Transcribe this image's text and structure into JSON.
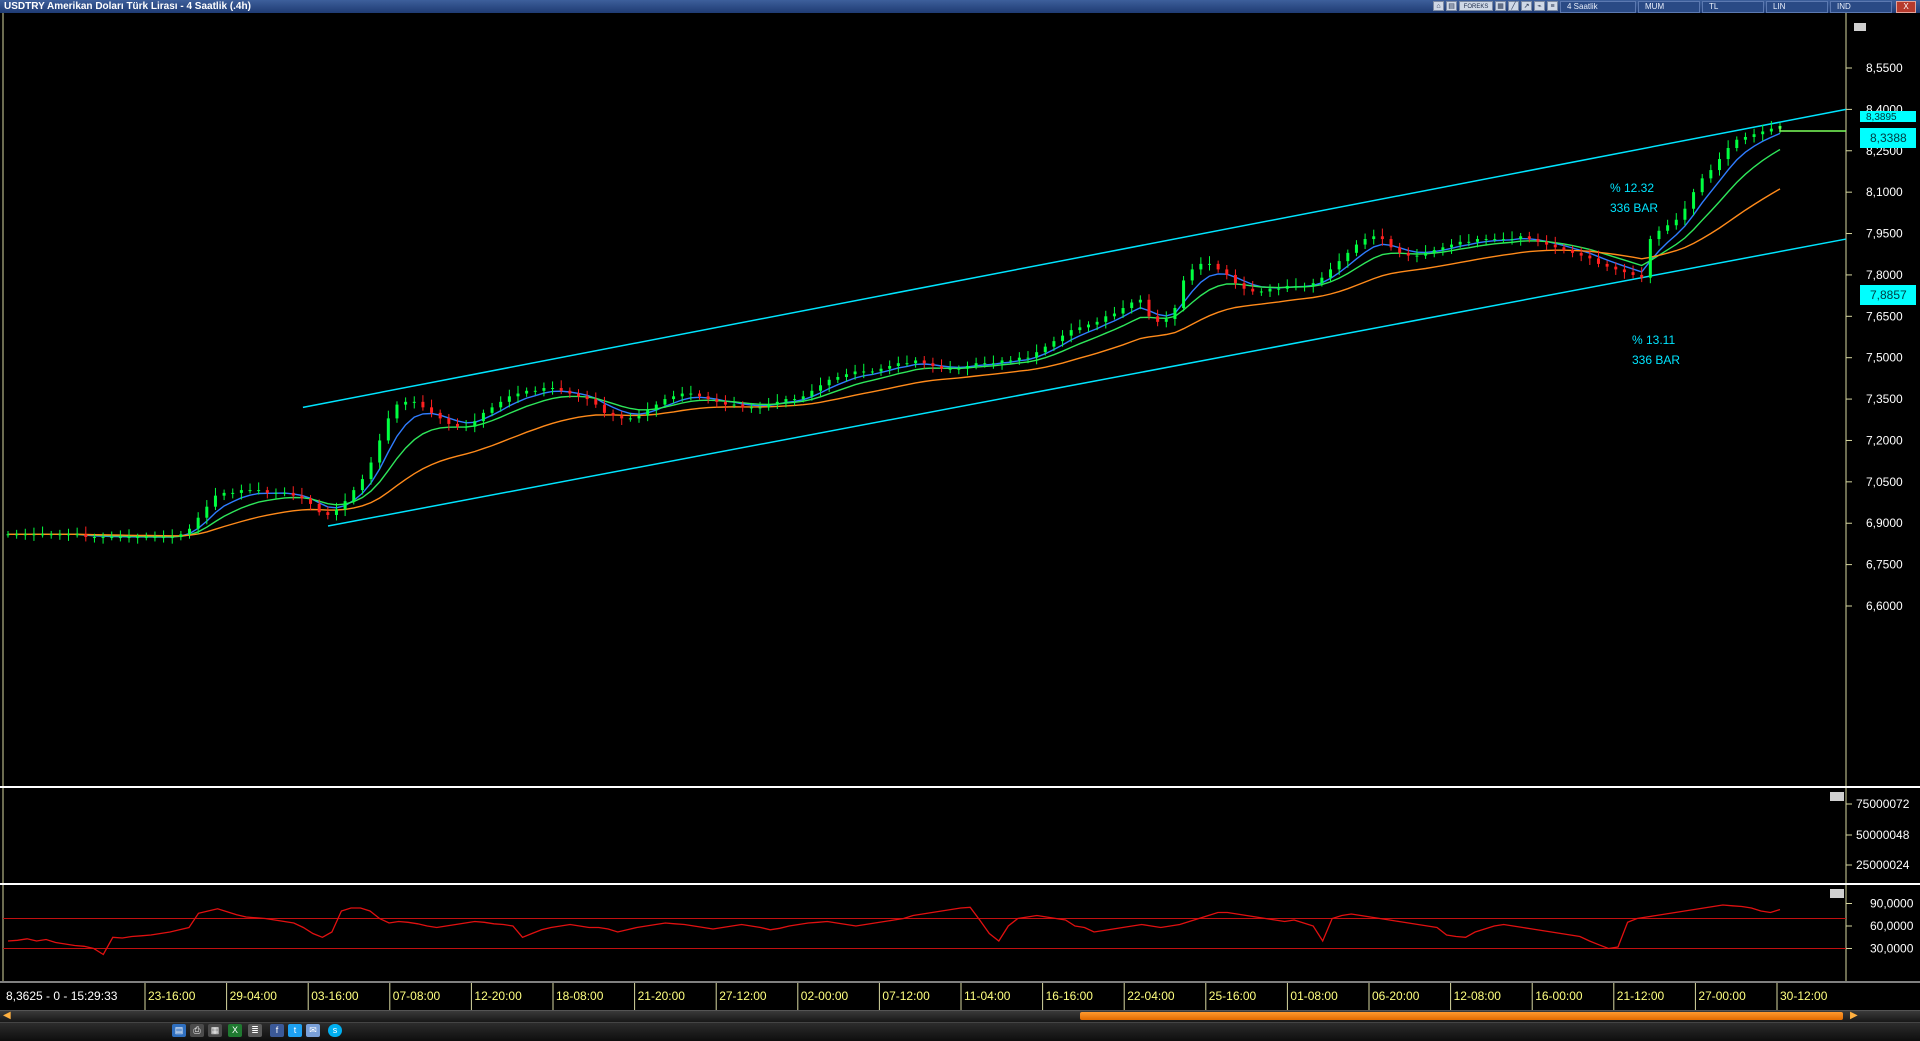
{
  "window": {
    "title": "USDTRY Amerikan Doları Türk Lirası - 4 Saatlik (.4h)"
  },
  "toolbar": {
    "icons": [
      "home-icon",
      "chart-icon",
      "forex-icon",
      "grid-icon",
      "draw-icon",
      "draw2-icon",
      "draw3-icon",
      "list-icon"
    ],
    "forex_label": "FOREKS",
    "buttons": [
      "4 Saatlik",
      "MUM",
      "TL",
      "LIN",
      "IND"
    ],
    "close_label": "X"
  },
  "status": {
    "cursor_readout": "8,3625 - 0 - 15:29:33"
  },
  "annotations": [
    {
      "pct": "% 12.32",
      "bars": "336 BAR"
    },
    {
      "pct": "% 13.11",
      "bars": "336 BAR"
    }
  ],
  "price_labels": {
    "last": "8,3388",
    "hidden": "8,3895",
    "level": "7,8857"
  },
  "colors": {
    "bull": "#00ff40",
    "bear": "#ff2020",
    "channel": "#00e5ff",
    "ma_fast": "#2f7cff",
    "ma_mid": "#2ee65a",
    "ma_slow": "#ff8a1a",
    "rsi": "#e01010",
    "rsi_band": "#c01010",
    "axis_text": "#ffffff",
    "time_text": "#ffff80"
  },
  "bottom_icons": [
    "excel-icon",
    "print-icon",
    "sheet-icon",
    "facebook-icon",
    "twitter-icon",
    "mail-icon",
    "skype-icon"
  ],
  "chart_data": {
    "type": "line",
    "title": "USDTRY Amerikan Doları Türk Lirası - 4 Saatlik (.4h)",
    "price_axis": {
      "ticks": [
        "8,5500",
        "8,4000",
        "8,2500",
        "8,1000",
        "7,9500",
        "7,8000",
        "7,6500",
        "7,5000",
        "7,3500",
        "7,2000",
        "7,0500",
        "6,9000",
        "6,7500",
        "6,6000"
      ],
      "tick_values": [
        8.55,
        8.4,
        8.25,
        8.1,
        7.95,
        7.8,
        7.65,
        7.5,
        7.35,
        7.2,
        7.05,
        6.9,
        6.75,
        6.6
      ]
    },
    "time_axis": {
      "ticks": [
        "23-16:00",
        "29-04:00",
        "03-16:00",
        "07-08:00",
        "12-20:00",
        "18-08:00",
        "21-20:00",
        "27-12:00",
        "02-00:00",
        "07-12:00",
        "11-04:00",
        "16-16:00",
        "22-04:00",
        "25-16:00",
        "01-08:00",
        "06-20:00",
        "12-08:00",
        "16-00:00",
        "21-12:00",
        "27-00:00",
        "30-12:00"
      ]
    },
    "series": [
      {
        "name": "close",
        "values": [
          6.86,
          6.86,
          6.86,
          6.86,
          6.86,
          6.86,
          6.86,
          6.86,
          6.86,
          6.85,
          6.85,
          6.85,
          6.85,
          6.85,
          6.85,
          6.85,
          6.85,
          6.85,
          6.85,
          6.85,
          6.86,
          6.88,
          6.92,
          6.96,
          7.0,
          7.01,
          7.01,
          7.02,
          7.02,
          7.02,
          7.01,
          7.01,
          7.01,
          7.0,
          6.99,
          6.97,
          6.94,
          6.93,
          6.95,
          6.98,
          7.02,
          7.06,
          7.12,
          7.2,
          7.28,
          7.33,
          7.34,
          7.34,
          7.32,
          7.3,
          7.28,
          7.26,
          7.25,
          7.25,
          7.27,
          7.3,
          7.32,
          7.34,
          7.36,
          7.37,
          7.38,
          7.38,
          7.39,
          7.39,
          7.38,
          7.37,
          7.36,
          7.35,
          7.33,
          7.3,
          7.29,
          7.28,
          7.28,
          7.29,
          7.31,
          7.33,
          7.35,
          7.36,
          7.37,
          7.37,
          7.36,
          7.35,
          7.34,
          7.33,
          7.33,
          7.32,
          7.32,
          7.32,
          7.33,
          7.34,
          7.35,
          7.35,
          7.36,
          7.38,
          7.4,
          7.42,
          7.43,
          7.44,
          7.45,
          7.45,
          7.45,
          7.46,
          7.47,
          7.48,
          7.48,
          7.49,
          7.48,
          7.47,
          7.46,
          7.46,
          7.46,
          7.47,
          7.48,
          7.48,
          7.48,
          7.49,
          7.49,
          7.5,
          7.5,
          7.52,
          7.54,
          7.56,
          7.58,
          7.6,
          7.61,
          7.62,
          7.63,
          7.65,
          7.66,
          7.68,
          7.7,
          7.71,
          7.65,
          7.63,
          7.64,
          7.68,
          7.78,
          7.82,
          7.84,
          7.84,
          7.82,
          7.8,
          7.77,
          7.75,
          7.74,
          7.74,
          7.75,
          7.75,
          7.76,
          7.76,
          7.76,
          7.77,
          7.79,
          7.82,
          7.85,
          7.88,
          7.91,
          7.93,
          7.94,
          7.93,
          7.9,
          7.88,
          7.87,
          7.87,
          7.88,
          7.89,
          7.9,
          7.91,
          7.92,
          7.92,
          7.93,
          7.93,
          7.93,
          7.93,
          7.93,
          7.94,
          7.93,
          7.92,
          7.91,
          7.9,
          7.89,
          7.88,
          7.87,
          7.86,
          7.84,
          7.83,
          7.82,
          7.81,
          7.8,
          7.79,
          7.93,
          7.96,
          7.98,
          8.0,
          8.04,
          8.1,
          8.15,
          8.18,
          8.22,
          8.26,
          8.29,
          8.3,
          8.31,
          8.32,
          8.33,
          8.34
        ]
      },
      {
        "name": "ma_fast"
      },
      {
        "name": "ma_mid"
      },
      {
        "name": "ma_slow"
      }
    ],
    "channel": {
      "upper": {
        "from": [
          0.1641,
          7.32
        ],
        "to": [
          1.0,
          8.4
        ]
      },
      "lower": {
        "from": [
          0.1777,
          6.89
        ],
        "to": [
          1.0,
          7.93
        ]
      }
    },
    "volume_axis": {
      "ticks": [
        "75000072",
        "50000048",
        "25000024"
      ]
    },
    "rsi": {
      "ticks": [
        "90,0000",
        "60,0000",
        "30,0000"
      ],
      "tick_values": [
        90,
        60,
        30
      ],
      "bands": [
        70,
        30
      ],
      "values": [
        40,
        41,
        43,
        40,
        42,
        38,
        36,
        34,
        33,
        30,
        22,
        45,
        44,
        46,
        47,
        48,
        50,
        52,
        55,
        58,
        77,
        80,
        83,
        79,
        75,
        72,
        71,
        70,
        68,
        66,
        64,
        58,
        50,
        45,
        52,
        80,
        84,
        84,
        80,
        70,
        64,
        66,
        65,
        63,
        60,
        58,
        60,
        62,
        64,
        66,
        65,
        63,
        62,
        60,
        45,
        50,
        55,
        58,
        60,
        62,
        60,
        58,
        58,
        56,
        52,
        55,
        58,
        60,
        62,
        64,
        63,
        62,
        60,
        58,
        56,
        58,
        60,
        62,
        60,
        58,
        55,
        57,
        60,
        62,
        64,
        65,
        66,
        64,
        62,
        60,
        62,
        64,
        66,
        68,
        70,
        74,
        76,
        78,
        80,
        82,
        84,
        85,
        68,
        50,
        40,
        60,
        70,
        72,
        74,
        72,
        70,
        68,
        60,
        58,
        52,
        54,
        56,
        58,
        60,
        62,
        60,
        58,
        60,
        62,
        66,
        70,
        74,
        78,
        78,
        76,
        74,
        72,
        70,
        68,
        66,
        68,
        64,
        60,
        40,
        70,
        74,
        76,
        74,
        72,
        70,
        68,
        66,
        64,
        62,
        60,
        58,
        48,
        46,
        45,
        52,
        56,
        60,
        62,
        60,
        58,
        56,
        54,
        52,
        50,
        48,
        46,
        40,
        35,
        30,
        32,
        65,
        70,
        72,
        74,
        76,
        78,
        80,
        82,
        84,
        86,
        88,
        87,
        86,
        84,
        80,
        78,
        82
      ]
    }
  }
}
